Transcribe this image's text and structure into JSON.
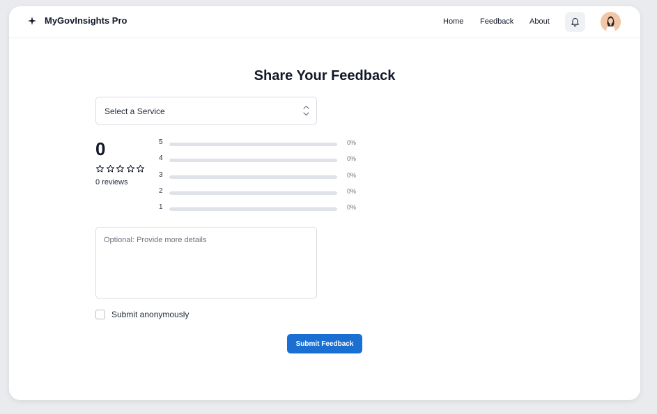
{
  "app": {
    "brand": "MyGovInsights Pro",
    "brand_icon": "sparkle-icon",
    "accent_color": "#1a6fd3"
  },
  "nav": {
    "links": [
      {
        "label": "Home"
      },
      {
        "label": "Feedback"
      },
      {
        "label": "About"
      }
    ],
    "notifications_icon": "bell-icon",
    "avatar": "user-avatar"
  },
  "page": {
    "title": "Share Your Feedback"
  },
  "service_select": {
    "selected": "Select a Service",
    "icon": "chevron-up-down-icon"
  },
  "rating": {
    "average": "0",
    "stars_filled": 0,
    "stars_total": 5,
    "reviews_text": "0 reviews",
    "distribution": [
      {
        "stars": "5",
        "fraction": 0,
        "percent": "0%"
      },
      {
        "stars": "4",
        "fraction": 0,
        "percent": "0%"
      },
      {
        "stars": "3",
        "fraction": 0,
        "percent": "0%"
      },
      {
        "stars": "2",
        "fraction": 0,
        "percent": "0%"
      },
      {
        "stars": "1",
        "fraction": 0,
        "percent": "0%"
      }
    ]
  },
  "details": {
    "placeholder": "Optional: Provide more details",
    "value": ""
  },
  "anonymous": {
    "label": "Submit anonymously",
    "checked": false
  },
  "submit": {
    "label": "Submit Feedback"
  }
}
